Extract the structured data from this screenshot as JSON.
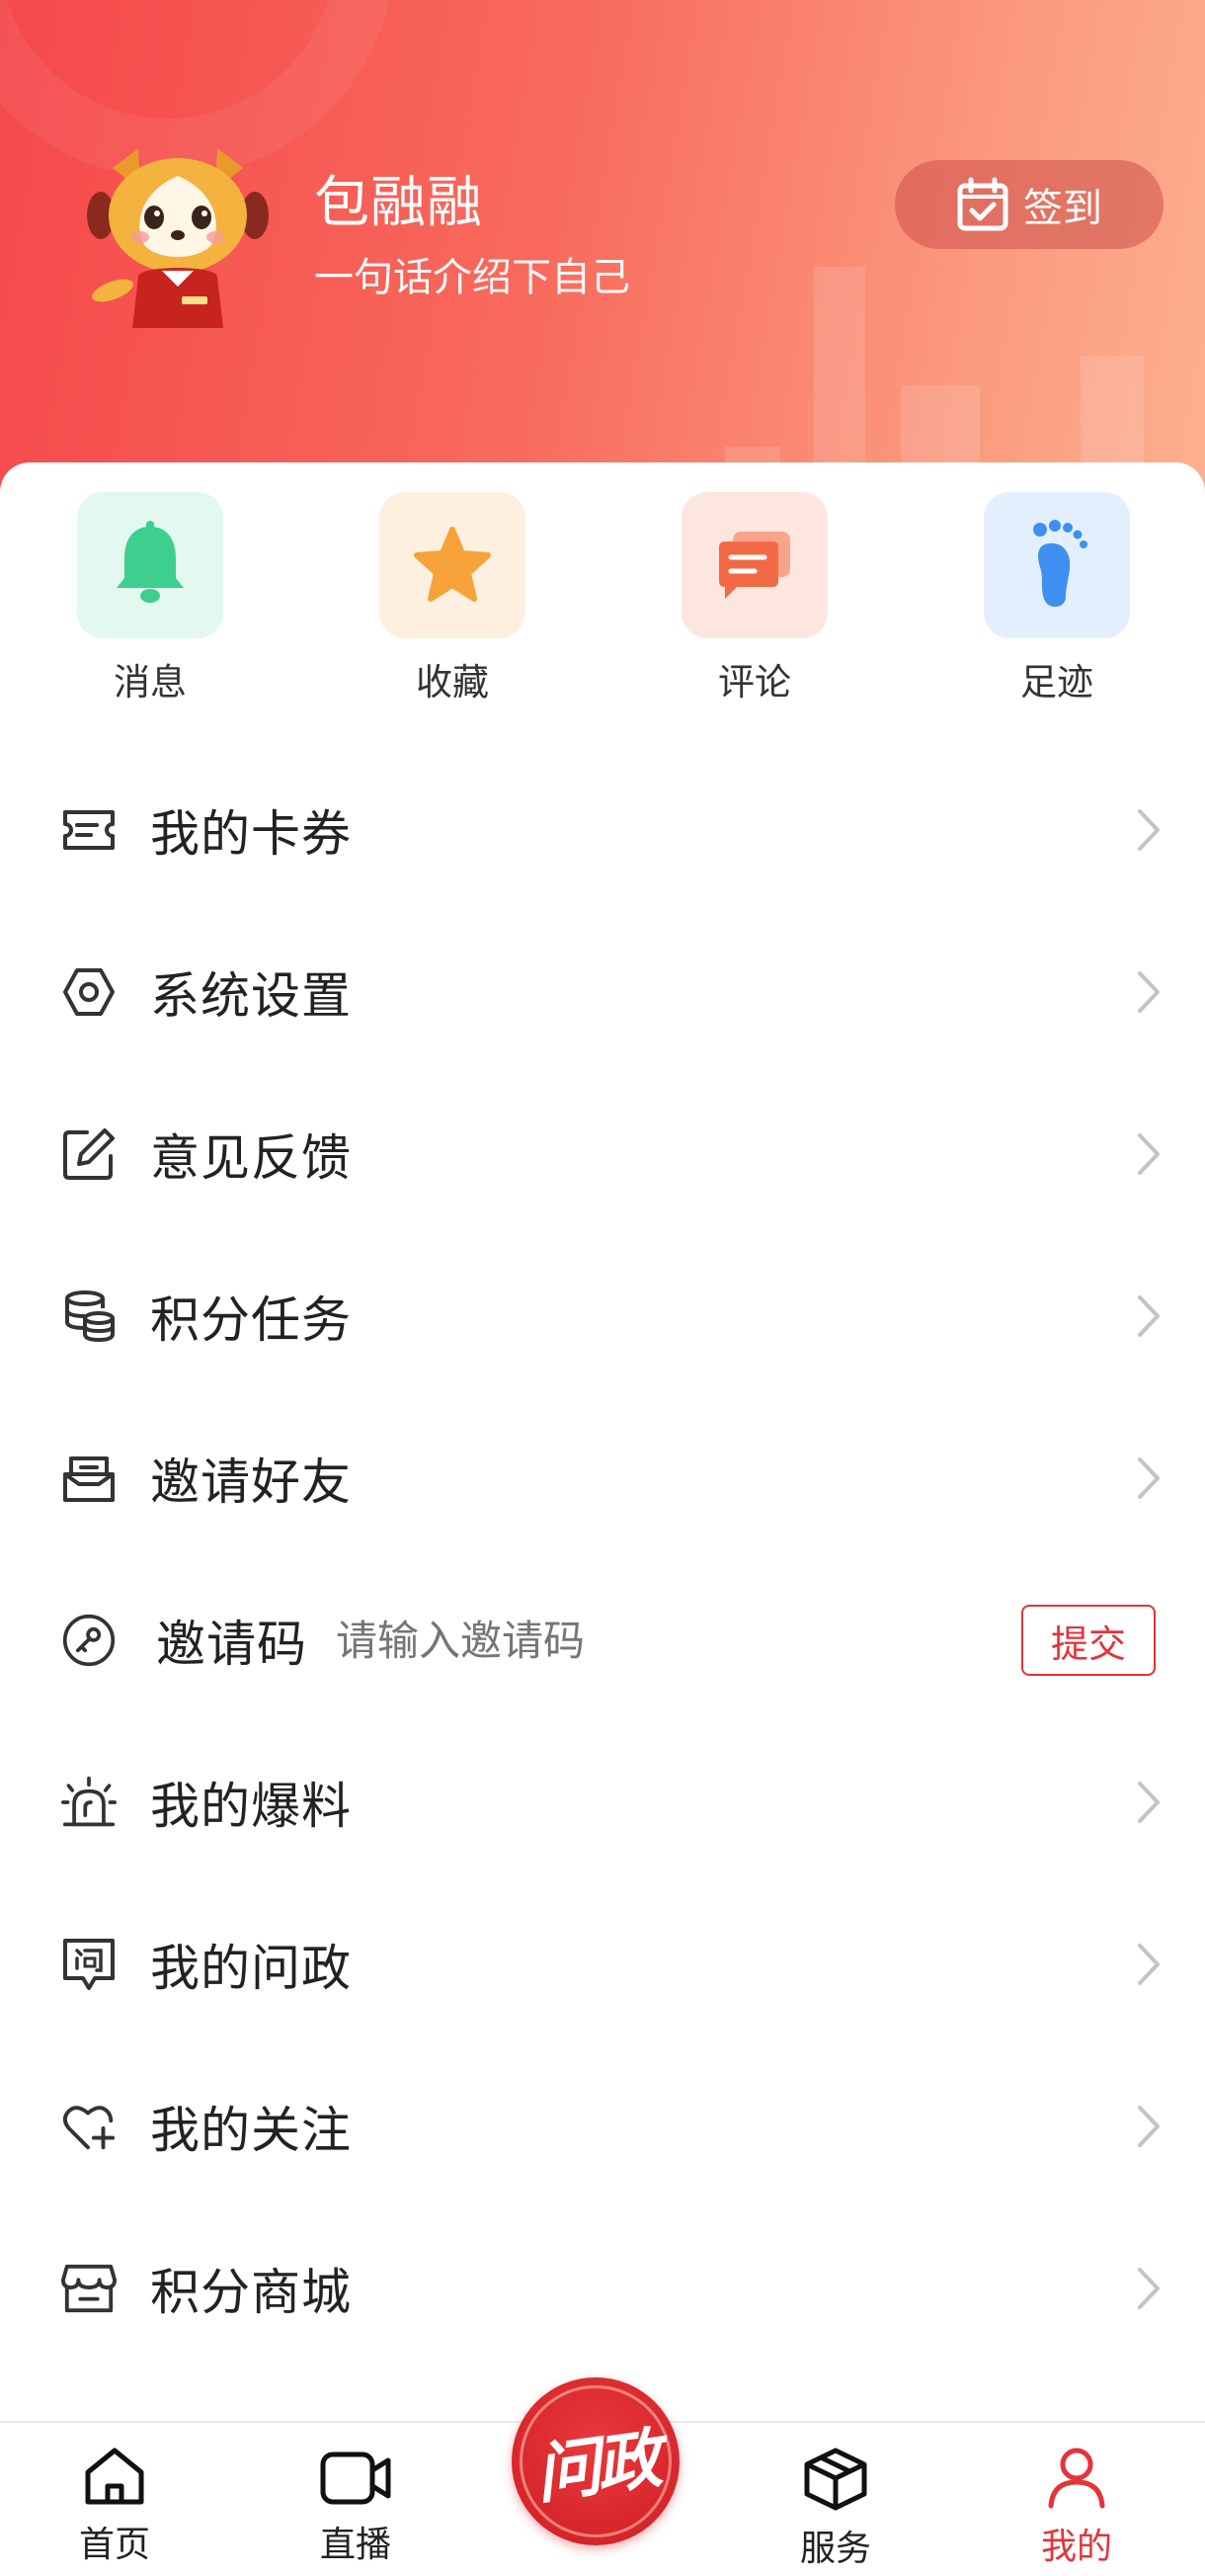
{
  "profile": {
    "name": "包融融",
    "bio": "一句话介绍下自己",
    "checkin_label": "签到"
  },
  "quick_actions": [
    {
      "label": "消息",
      "icon": "bell-icon",
      "bg": "#e3f8ee",
      "color": "#3ccf8e"
    },
    {
      "label": "收藏",
      "icon": "star-icon",
      "bg": "#fdf0e0",
      "color": "#f7a23a"
    },
    {
      "label": "评论",
      "icon": "comment-icon",
      "bg": "#fde6df",
      "color": "#f26a45"
    },
    {
      "label": "足迹",
      "icon": "footprint-icon",
      "bg": "#e4effd",
      "color": "#3f8ff0"
    }
  ],
  "menu": [
    {
      "label": "我的卡券",
      "icon": "coupon-icon"
    },
    {
      "label": "系统设置",
      "icon": "settings-icon"
    },
    {
      "label": "意见反馈",
      "icon": "feedback-icon"
    },
    {
      "label": "积分任务",
      "icon": "coins-icon"
    },
    {
      "label": "邀请好友",
      "icon": "invite-icon"
    },
    {
      "label": "邀请码",
      "icon": "key-icon",
      "input_placeholder": "请输入邀请码",
      "button": "提交"
    },
    {
      "label": "我的爆料",
      "icon": "alarm-icon"
    },
    {
      "label": "我的问政",
      "icon": "inquiry-icon"
    },
    {
      "label": "我的关注",
      "icon": "heart-plus-icon"
    },
    {
      "label": "积分商城",
      "icon": "store-icon"
    }
  ],
  "tabbar": {
    "tabs": [
      {
        "label": "首页",
        "icon": "home-icon"
      },
      {
        "label": "直播",
        "icon": "video-icon"
      },
      {
        "label": "服务",
        "icon": "cube-icon"
      },
      {
        "label": "我的",
        "icon": "user-icon",
        "active": true
      }
    ],
    "center_label": "问政"
  },
  "colors": {
    "accent": "#e5333a",
    "header_start": "#f5484b",
    "header_end": "#fcb08f"
  }
}
